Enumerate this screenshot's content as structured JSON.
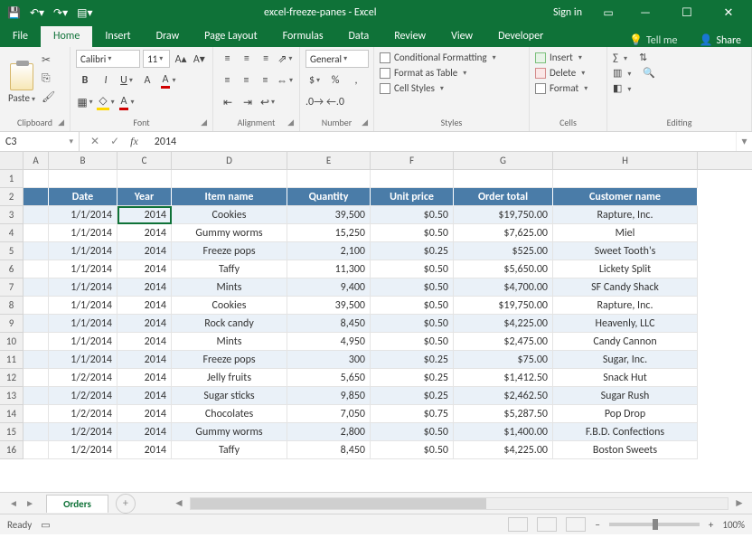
{
  "titlebar": {
    "title": "excel-freeze-panes - Excel",
    "sign_in": "Sign in"
  },
  "tabs": {
    "file": "File",
    "home": "Home",
    "insert": "Insert",
    "draw": "Draw",
    "page_layout": "Page Layout",
    "formulas": "Formulas",
    "data": "Data",
    "review": "Review",
    "view": "View",
    "developer": "Developer",
    "tell_me": "Tell me",
    "share": "Share"
  },
  "ribbon": {
    "clipboard": {
      "paste": "Paste",
      "label": "Clipboard"
    },
    "font": {
      "name": "Calibri",
      "size": "11",
      "label": "Font"
    },
    "alignment": {
      "label": "Alignment"
    },
    "number": {
      "format": "General",
      "label": "Number"
    },
    "styles": {
      "cond": "Conditional Formatting",
      "table": "Format as Table",
      "cell": "Cell Styles",
      "label": "Styles"
    },
    "cells": {
      "insert": "Insert",
      "delete": "Delete",
      "format": "Format",
      "label": "Cells"
    },
    "editing": {
      "label": "Editing"
    }
  },
  "namebox": {
    "ref": "C3"
  },
  "formula": {
    "value": "2014"
  },
  "cols": {
    "A": "A",
    "B": "B",
    "C": "C",
    "D": "D",
    "E": "E",
    "F": "F",
    "G": "G",
    "H": "H"
  },
  "col_widths": {
    "A": 28,
    "B": 76,
    "C": 60,
    "D": 128,
    "E": 92,
    "F": 92,
    "G": 110,
    "H": 160
  },
  "table": {
    "headers": {
      "date": "Date",
      "year": "Year",
      "item": "Item name",
      "qty": "Quantity",
      "price": "Unit price",
      "total": "Order total",
      "cust": "Customer name"
    },
    "rows": [
      {
        "date": "1/1/2014",
        "year": "2014",
        "item": "Cookies",
        "qty": "39,500",
        "price": "$0.50",
        "total": "$19,750.00",
        "cust": "Rapture, Inc."
      },
      {
        "date": "1/1/2014",
        "year": "2014",
        "item": "Gummy worms",
        "qty": "15,250",
        "price": "$0.50",
        "total": "$7,625.00",
        "cust": "Miel"
      },
      {
        "date": "1/1/2014",
        "year": "2014",
        "item": "Freeze pops",
        "qty": "2,100",
        "price": "$0.25",
        "total": "$525.00",
        "cust": "Sweet Tooth's"
      },
      {
        "date": "1/1/2014",
        "year": "2014",
        "item": "Taffy",
        "qty": "11,300",
        "price": "$0.50",
        "total": "$5,650.00",
        "cust": "Lickety Split"
      },
      {
        "date": "1/1/2014",
        "year": "2014",
        "item": "Mints",
        "qty": "9,400",
        "price": "$0.50",
        "total": "$4,700.00",
        "cust": "SF Candy Shack"
      },
      {
        "date": "1/1/2014",
        "year": "2014",
        "item": "Cookies",
        "qty": "39,500",
        "price": "$0.50",
        "total": "$19,750.00",
        "cust": "Rapture, Inc."
      },
      {
        "date": "1/1/2014",
        "year": "2014",
        "item": "Rock candy",
        "qty": "8,450",
        "price": "$0.50",
        "total": "$4,225.00",
        "cust": "Heavenly, LLC"
      },
      {
        "date": "1/1/2014",
        "year": "2014",
        "item": "Mints",
        "qty": "4,950",
        "price": "$0.50",
        "total": "$2,475.00",
        "cust": "Candy Cannon"
      },
      {
        "date": "1/1/2014",
        "year": "2014",
        "item": "Freeze pops",
        "qty": "300",
        "price": "$0.25",
        "total": "$75.00",
        "cust": "Sugar, Inc."
      },
      {
        "date": "1/2/2014",
        "year": "2014",
        "item": "Jelly fruits",
        "qty": "5,650",
        "price": "$0.25",
        "total": "$1,412.50",
        "cust": "Snack Hut"
      },
      {
        "date": "1/2/2014",
        "year": "2014",
        "item": "Sugar sticks",
        "qty": "9,850",
        "price": "$0.25",
        "total": "$2,462.50",
        "cust": "Sugar Rush"
      },
      {
        "date": "1/2/2014",
        "year": "2014",
        "item": "Chocolates",
        "qty": "7,050",
        "price": "$0.75",
        "total": "$5,287.50",
        "cust": "Pop Drop"
      },
      {
        "date": "1/2/2014",
        "year": "2014",
        "item": "Gummy worms",
        "qty": "2,800",
        "price": "$0.50",
        "total": "$1,400.00",
        "cust": "F.B.D. Confections"
      },
      {
        "date": "1/2/2014",
        "year": "2014",
        "item": "Taffy",
        "qty": "8,450",
        "price": "$0.50",
        "total": "$4,225.00",
        "cust": "Boston Sweets"
      }
    ]
  },
  "sheet": {
    "name": "Orders"
  },
  "status": {
    "ready": "Ready",
    "zoom": "100%"
  }
}
